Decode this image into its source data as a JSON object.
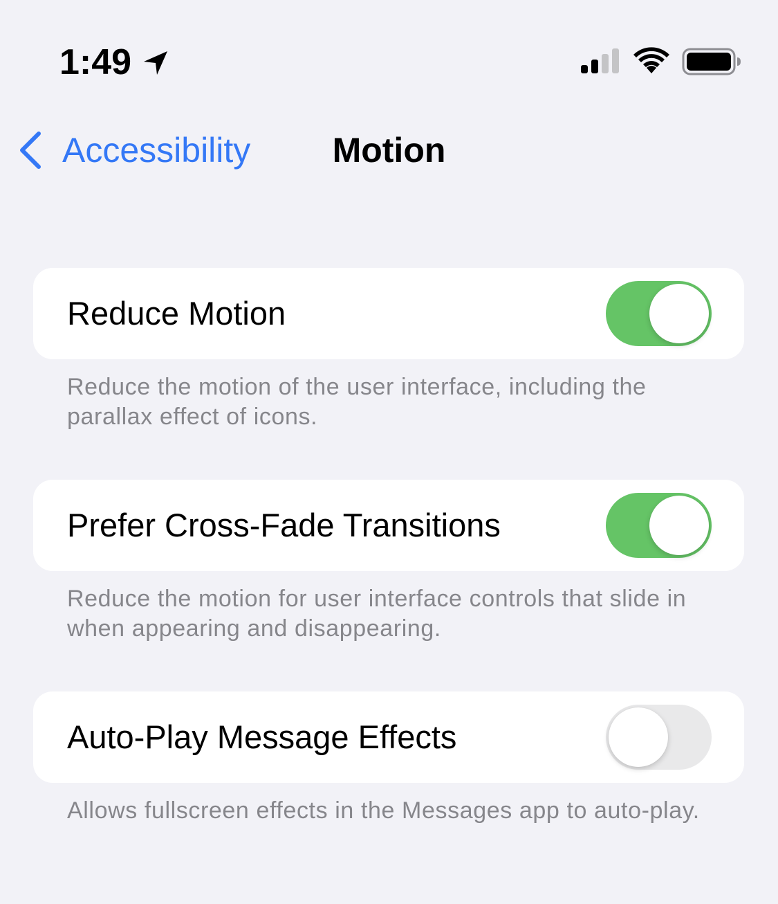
{
  "status_bar": {
    "time": "1:49",
    "location_icon": "location-arrow-icon",
    "signal_icon": "cellular-signal-icon",
    "wifi_icon": "wifi-icon",
    "battery_icon": "battery-icon"
  },
  "nav": {
    "back_label": "Accessibility",
    "back_icon": "chevron-left-icon",
    "title": "Motion"
  },
  "colors": {
    "accent": "#3478f6",
    "toggle_on": "#65c466",
    "toggle_off": "#e9e9ea",
    "background": "#f2f2f7",
    "footnote": "#86868b"
  },
  "settings": [
    {
      "label": "Reduce Motion",
      "enabled": true,
      "footnote": "Reduce the motion of the user interface, including the parallax effect of icons."
    },
    {
      "label": "Prefer Cross-Fade Transitions",
      "enabled": true,
      "footnote": "Reduce the motion for user interface controls that slide in when appearing and disappearing."
    },
    {
      "label": "Auto-Play Message Effects",
      "enabled": false,
      "footnote": "Allows fullscreen effects in the Messages app to auto-play."
    }
  ]
}
